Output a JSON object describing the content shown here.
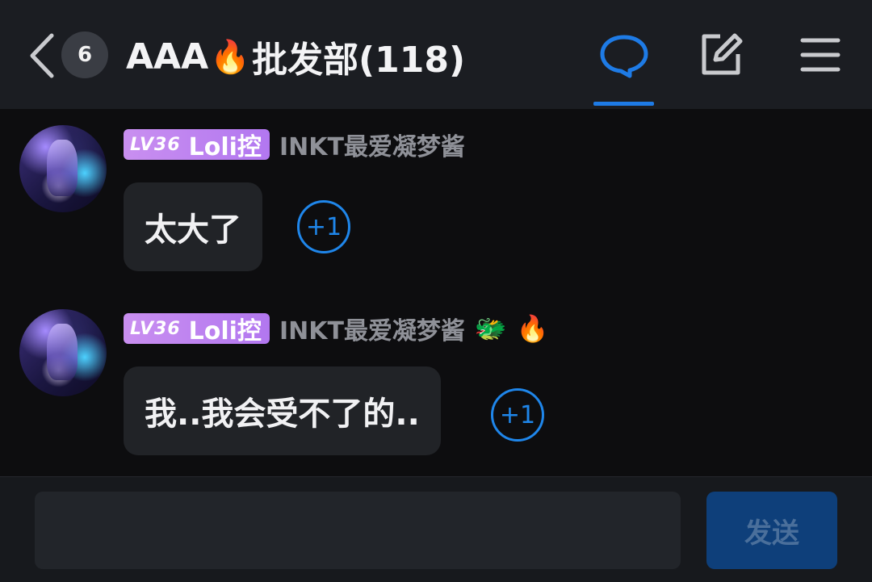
{
  "header": {
    "unread_count": "6",
    "title_prefix": "AAA",
    "title_emoji": "🔥",
    "title_suffix": "批发部(118)",
    "icons": {
      "back": "chevron-left-icon",
      "chat": "chat-bubble-icon",
      "edit": "edit-note-icon",
      "menu": "hamburger-menu-icon"
    },
    "accent_color": "#1e7be6"
  },
  "messages": [
    {
      "level": "LV36",
      "badge_title": "Loli控",
      "sender": "INKT最爱凝梦酱",
      "emojis": [],
      "text": "太大了",
      "plus_one": "+1"
    },
    {
      "level": "LV36",
      "badge_title": "Loli控",
      "sender": "INKT最爱凝梦酱",
      "emojis": [
        "🐲",
        "🔥"
      ],
      "text": "我..我会受不了的..",
      "plus_one": "+1"
    }
  ],
  "composer": {
    "placeholder": "",
    "value": "",
    "send_label": "发送"
  },
  "colors": {
    "level_badge": "#c98ff0",
    "plus_one": "#1f86ea",
    "send_button": "#0e3f7a"
  }
}
